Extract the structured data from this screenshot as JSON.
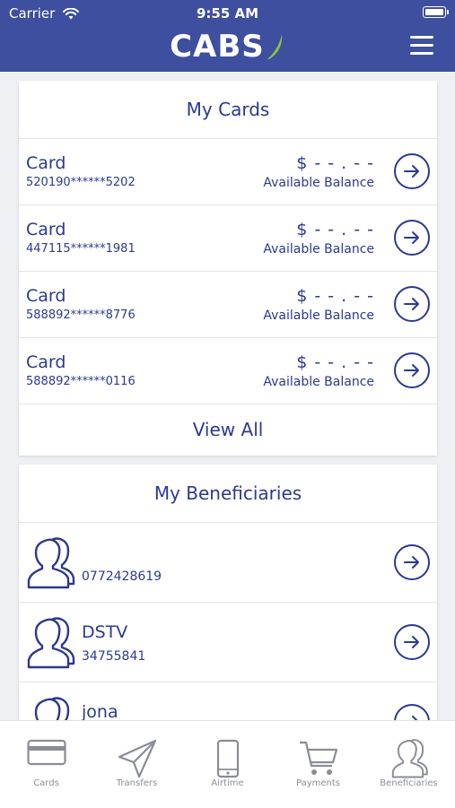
{
  "status_bar": {
    "carrier": "Carrier",
    "time": "9:55 AM",
    "icons": [
      "wifi-icon",
      "battery-icon"
    ]
  },
  "header": {
    "brand": "CABS",
    "menu_icon": "hamburger-menu-icon"
  },
  "cards_section": {
    "title": "My Cards",
    "cards": [
      {
        "type": "Card",
        "number": "520190******5202",
        "balance": "$ - - . - -",
        "balance_label": "Available Balance"
      },
      {
        "type": "Card",
        "number": "447115******1981",
        "balance": "$ - - . - -",
        "balance_label": "Available Balance"
      },
      {
        "type": "Card",
        "number": "588892******8776",
        "balance": "$ - - . - -",
        "balance_label": "Available Balance"
      },
      {
        "type": "Card",
        "number": "588892******0116",
        "balance": "$ - - . - -",
        "balance_label": "Available Balance"
      }
    ],
    "view_all": "View All"
  },
  "beneficiaries_section": {
    "title": "My Beneficiaries",
    "items": [
      {
        "name": "",
        "account": "0772428619"
      },
      {
        "name": "DSTV",
        "account": "34755841"
      },
      {
        "name": "jona",
        "account": ""
      }
    ]
  },
  "tabbar": {
    "tabs": [
      {
        "label": "Cards",
        "icon": "credit-card-icon"
      },
      {
        "label": "Transfers",
        "icon": "paper-plane-icon"
      },
      {
        "label": "Airtime",
        "icon": "mobile-phone-icon"
      },
      {
        "label": "Payments",
        "icon": "shopping-cart-icon"
      },
      {
        "label": "Beneficiaries",
        "icon": "users-icon"
      }
    ]
  },
  "colors": {
    "header_bg": "#3d4f9e",
    "accent": "#2b3990",
    "page_bg": "#eef0f3",
    "tab_inactive": "#8a8d96",
    "logo_swoosh": "#8dc63f"
  }
}
